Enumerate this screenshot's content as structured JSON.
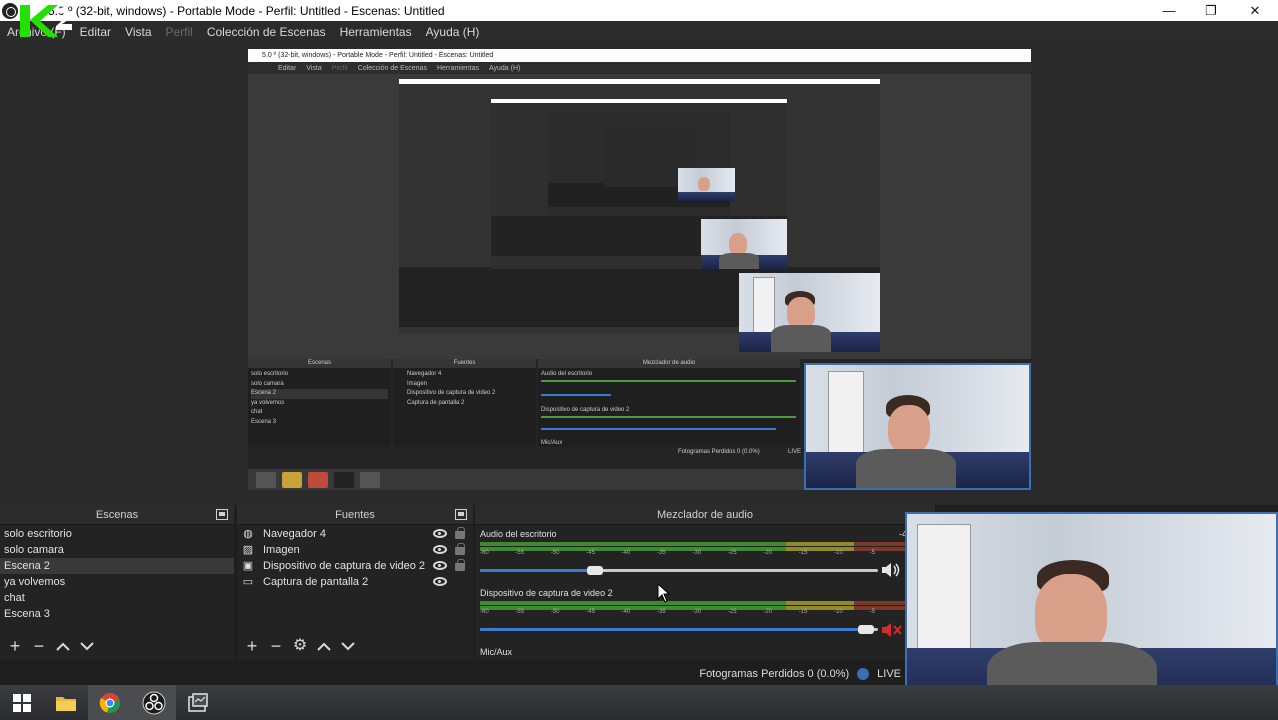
{
  "window": {
    "title": "5.0 º (32-bit, windows) - Portable Mode - Perfil: Untitled - Escenas: Untitled",
    "minimize_glyph": "—",
    "restore_glyph": "❐",
    "close_glyph": "✕"
  },
  "menu": {
    "archivo": "Archivo (F)",
    "editar": "Editar",
    "vista": "Vista",
    "perfil": "Perfil",
    "coleccion": "Colección de Escenas",
    "herramientas": "Herramientas",
    "ayuda": "Ayuda (H)"
  },
  "nested": {
    "title": "5.0 º (32-bit, windows) - Portable Mode - Perfil: Untitled - Escenas: Untitled",
    "menu": [
      "Editar",
      "Vista",
      "Perfil",
      "Colección de Escenas",
      "Herramientas",
      "Ayuda (H)"
    ],
    "scenes_header": "Escenas",
    "sources_header": "Fuentes",
    "mixer_header": "Mezclador de audio",
    "scenes": [
      "solo escritorio",
      "solo camara",
      "Escena 2",
      "ya volvemos",
      "chat",
      "Escena 3"
    ],
    "sources": [
      "Navegador 4",
      "Imagen",
      "Dispositivo de captura de video 2",
      "Captura de pantalla 2"
    ],
    "track1": "Audio del escritorio",
    "track2": "Dispositivo de captura de video 2",
    "track3": "Mic/Aux",
    "status": "Fotogramas Perdidos 0 (0.0%)",
    "live": "LIVE"
  },
  "scenes": {
    "header": "Escenas",
    "items": [
      "solo escritorio",
      "solo camara",
      "Escena 2",
      "ya volvemos",
      "chat",
      "Escena 3"
    ],
    "selected_index": 2
  },
  "sources": {
    "header": "Fuentes",
    "items": [
      {
        "label": "Navegador 4",
        "icon": "globe-icon"
      },
      {
        "label": "Imagen",
        "icon": "image-icon"
      },
      {
        "label": "Dispositivo de captura de video 2",
        "icon": "camera-icon"
      },
      {
        "label": "Captura de pantalla 2",
        "icon": "monitor-icon"
      }
    ]
  },
  "mixer": {
    "header": "Mezclador de audio",
    "tracks": [
      {
        "name": "Audio del escritorio",
        "volume": 0.29,
        "muted": false,
        "edge_value": "-4"
      },
      {
        "name": "Dispositivo de captura de video 2",
        "volume": 0.97,
        "muted": true
      },
      {
        "name": "Mic/Aux"
      }
    ],
    "ticks": [
      "-60",
      "-55",
      "-50",
      "-45",
      "-40",
      "-35",
      "-30",
      "-25",
      "-20",
      "-15",
      "-10",
      "-5"
    ]
  },
  "status": {
    "dropped_frames": "Fotogramas Perdidos 0 (0.0%)",
    "live": "LIVE"
  },
  "colors": {
    "accent_blue": "#3b7bd4",
    "meter_green": "#3e8a2f",
    "mute_red": "#d42b2b",
    "logo_green": "#22e000"
  }
}
